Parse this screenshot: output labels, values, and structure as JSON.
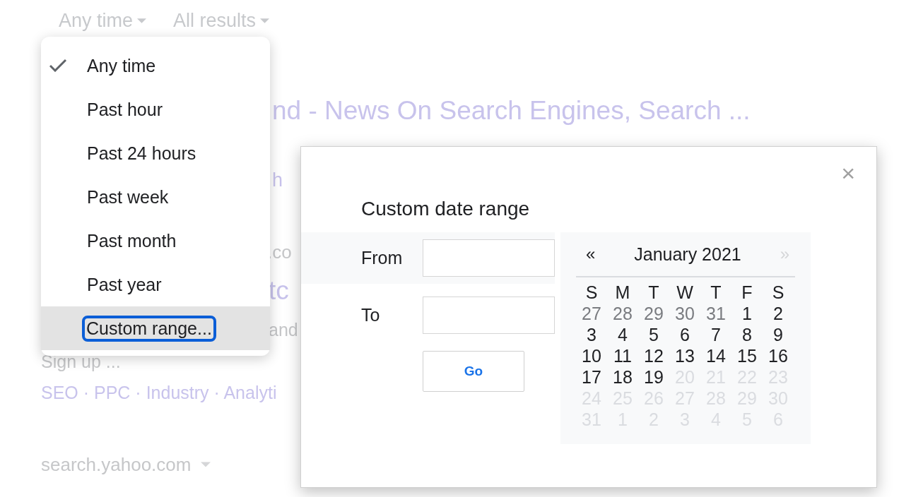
{
  "toolbar": [
    {
      "label": "Any time"
    },
    {
      "label": "All results"
    }
  ],
  "results": [
    {
      "kind": "title",
      "text": "nd - News On Search Engines, Search ..."
    },
    {
      "kind": "link",
      "text": "h"
    },
    {
      "kind": "url",
      "text": ".co"
    },
    {
      "kind": "title",
      "text": "tc"
    },
    {
      "kind": "snippet",
      "text": "and"
    },
    {
      "kind": "snippet",
      "text": "Sign up ..."
    },
    {
      "kind": "links",
      "text": "SEO · PPC · Industry · Analyti"
    },
    {
      "kind": "url_dropdown",
      "text": "search.yahoo.com"
    }
  ],
  "menu": {
    "items": [
      {
        "label": "Any time",
        "checked": true,
        "selected": false
      },
      {
        "label": "Past hour",
        "checked": false,
        "selected": false
      },
      {
        "label": "Past 24 hours",
        "checked": false,
        "selected": false
      },
      {
        "label": "Past week",
        "checked": false,
        "selected": false
      },
      {
        "label": "Past month",
        "checked": false,
        "selected": false
      },
      {
        "label": "Past year",
        "checked": false,
        "selected": false
      },
      {
        "label": "Custom range...",
        "checked": false,
        "selected": true
      }
    ]
  },
  "dialog": {
    "title": "Custom date range",
    "close": "×",
    "from": {
      "label": "From"
    },
    "to": {
      "label": "To"
    },
    "go": "Go",
    "calendar": {
      "prev": "«",
      "month": "January 2021",
      "next": "»",
      "next_disabled": true,
      "weekdays": [
        "S",
        "M",
        "T",
        "W",
        "T",
        "F",
        "S"
      ],
      "weeks": [
        [
          {
            "day": "27",
            "kind": "other"
          },
          {
            "day": "28",
            "kind": "other"
          },
          {
            "day": "29",
            "kind": "other"
          },
          {
            "day": "30",
            "kind": "other"
          },
          {
            "day": "31",
            "kind": "other"
          },
          {
            "day": "1",
            "kind": "current"
          },
          {
            "day": "2",
            "kind": "current"
          }
        ],
        [
          {
            "day": "3",
            "kind": "current"
          },
          {
            "day": "4",
            "kind": "current"
          },
          {
            "day": "5",
            "kind": "current"
          },
          {
            "day": "6",
            "kind": "current"
          },
          {
            "day": "7",
            "kind": "current"
          },
          {
            "day": "8",
            "kind": "current"
          },
          {
            "day": "9",
            "kind": "current"
          }
        ],
        [
          {
            "day": "10",
            "kind": "current"
          },
          {
            "day": "11",
            "kind": "current"
          },
          {
            "day": "12",
            "kind": "current"
          },
          {
            "day": "13",
            "kind": "current"
          },
          {
            "day": "14",
            "kind": "current"
          },
          {
            "day": "15",
            "kind": "current"
          },
          {
            "day": "16",
            "kind": "current"
          }
        ],
        [
          {
            "day": "17",
            "kind": "current"
          },
          {
            "day": "18",
            "kind": "current"
          },
          {
            "day": "19",
            "kind": "current"
          },
          {
            "day": "20",
            "kind": "disabled"
          },
          {
            "day": "21",
            "kind": "disabled"
          },
          {
            "day": "22",
            "kind": "disabled"
          },
          {
            "day": "23",
            "kind": "disabled"
          }
        ],
        [
          {
            "day": "24",
            "kind": "disabled"
          },
          {
            "day": "25",
            "kind": "disabled"
          },
          {
            "day": "26",
            "kind": "disabled"
          },
          {
            "day": "27",
            "kind": "disabled"
          },
          {
            "day": "28",
            "kind": "disabled"
          },
          {
            "day": "29",
            "kind": "disabled"
          },
          {
            "day": "30",
            "kind": "disabled"
          }
        ],
        [
          {
            "day": "31",
            "kind": "disabled"
          },
          {
            "day": "1",
            "kind": "disabled"
          },
          {
            "day": "2",
            "kind": "disabled"
          },
          {
            "day": "3",
            "kind": "disabled"
          },
          {
            "day": "4",
            "kind": "disabled"
          },
          {
            "day": "5",
            "kind": "disabled"
          },
          {
            "day": "6",
            "kind": "disabled"
          }
        ]
      ]
    }
  }
}
